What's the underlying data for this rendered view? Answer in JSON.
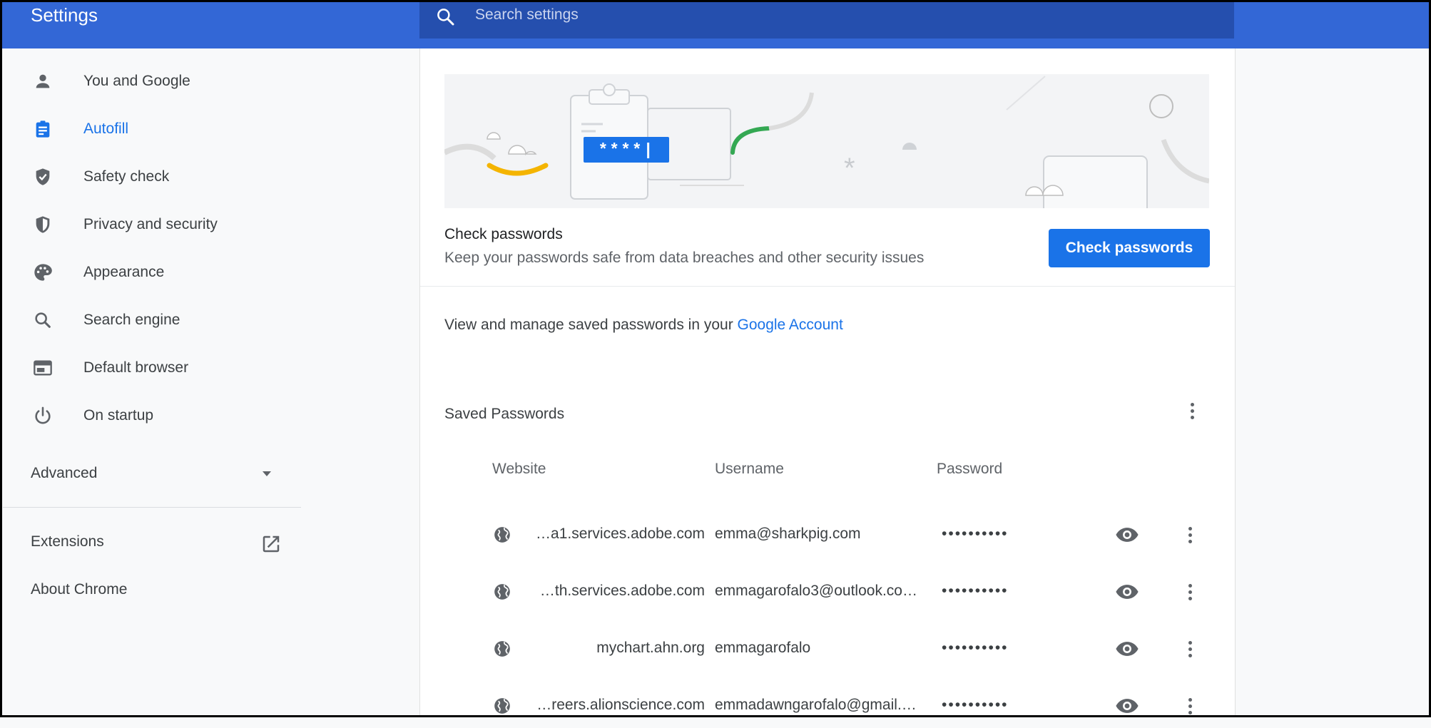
{
  "app_title": "Settings",
  "search": {
    "placeholder": "Search settings"
  },
  "sidebar": {
    "items": [
      {
        "label": "You and Google",
        "icon": "person-icon"
      },
      {
        "label": "Autofill",
        "icon": "clipboard-icon",
        "active": true
      },
      {
        "label": "Safety check",
        "icon": "shield-check-icon"
      },
      {
        "label": "Privacy and security",
        "icon": "shield-icon"
      },
      {
        "label": "Appearance",
        "icon": "palette-icon"
      },
      {
        "label": "Search engine",
        "icon": "search-icon"
      },
      {
        "label": "Default browser",
        "icon": "browser-icon"
      },
      {
        "label": "On startup",
        "icon": "power-icon"
      }
    ],
    "advanced_label": "Advanced",
    "extensions_label": "Extensions",
    "about_label": "About Chrome"
  },
  "check_passwords": {
    "banner_text": "****|",
    "title": "Check passwords",
    "subtitle": "Keep your passwords safe from data breaches and other security issues",
    "button_label": "Check passwords"
  },
  "manage": {
    "prefix": "View and manage saved passwords in your ",
    "link_label": "Google Account"
  },
  "saved_passwords": {
    "title": "Saved Passwords",
    "columns": [
      "Website",
      "Username",
      "Password"
    ],
    "rows": [
      {
        "website": "…a1.services.adobe.com",
        "username": "emma@sharkpig.com",
        "password": "••••••••••"
      },
      {
        "website": "…th.services.adobe.com",
        "username": "emmagarofalo3@outlook.co…",
        "password": "••••••••••"
      },
      {
        "website": "mychart.ahn.org",
        "username": "emmagarofalo",
        "password": "••••••••••"
      },
      {
        "website": "…reers.alionscience.com",
        "username": "emmadawngarofalo@gmail.…",
        "password": "••••••••••"
      }
    ]
  },
  "colors": {
    "header": "#3367d6",
    "search_bg": "#254fae",
    "accent": "#1a73e8",
    "sidebar_bg": "#f8f9fa"
  }
}
